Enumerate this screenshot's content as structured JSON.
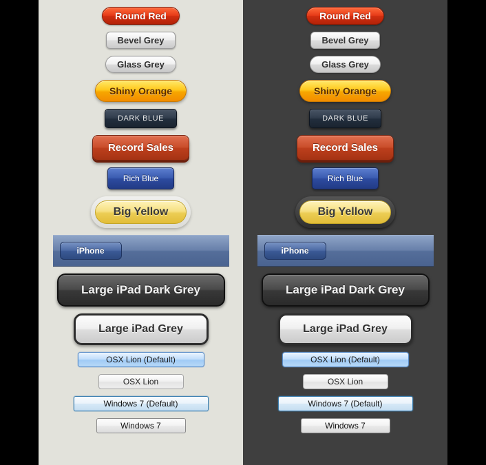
{
  "buttons": {
    "round_red": "Round Red",
    "bevel_grey": "Bevel Grey",
    "glass_grey": "Glass Grey",
    "shiny_orange": "Shiny Orange",
    "dark_blue": "DARK BLUE",
    "record_sales": "Record Sales",
    "rich_blue": "Rich Blue",
    "big_yellow": "Big Yellow",
    "iphone": "iPhone",
    "ipad_dark": "Large iPad Dark Grey",
    "ipad_grey": "Large iPad Grey",
    "osx_default": "OSX Lion (Default)",
    "osx": "OSX Lion",
    "win7_default": "Windows 7 (Default)",
    "win7": "Windows 7"
  },
  "panels": {
    "light": "light-background-panel",
    "dark": "dark-background-panel"
  }
}
